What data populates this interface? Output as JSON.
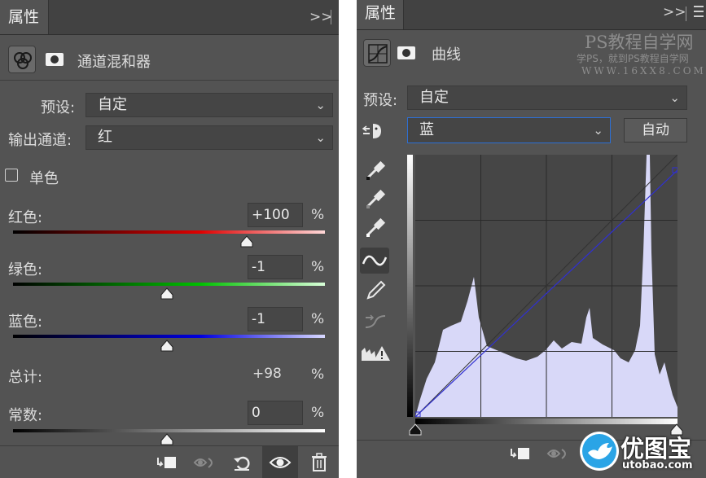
{
  "left": {
    "tab_title": "属性",
    "tab_collapse": ">>",
    "panel_title": "通道混和器",
    "preset_label": "预设:",
    "preset_value": "自定",
    "output_label": "输出通道:",
    "output_value": "红",
    "mono_label": "单色",
    "mono_checked": false,
    "channels": [
      {
        "label": "红色:",
        "value": "+100",
        "unit": "%",
        "level": 1.0
      },
      {
        "label": "绿色:",
        "value": "-1",
        "unit": "%",
        "level": -0.01
      },
      {
        "label": "蓝色:",
        "value": "-1",
        "unit": "%",
        "level": -0.01
      }
    ],
    "total_label": "总计:",
    "total_value": "+98",
    "total_unit": "%",
    "constant_label": "常数:",
    "constant_value": "0",
    "constant_unit": "%",
    "constant_level": 0.0,
    "bottom_icons": [
      "clip-to-layer-icon",
      "toggle-visibility-preview-icon",
      "reset-icon",
      "eye-icon",
      "trash-icon"
    ]
  },
  "right": {
    "tab_title": "属性",
    "tab_collapse": ">>",
    "panel_title": "曲线",
    "watermark_title": "PS教程自学网",
    "watermark_sub": "学PS，就到PS教程自学网",
    "watermark_url": "WWW.16XX8.COM",
    "preset_label": "预设:",
    "preset_value": "自定",
    "channel_value": "蓝",
    "auto_label": "自动",
    "tools": [
      "on-image-adjust-icon",
      "black-point-eyedropper-icon",
      "gray-point-eyedropper-icon",
      "white-point-eyedropper-icon",
      "curve-points-icon",
      "pencil-icon",
      "smooth-icon",
      "clipping-warning-icon"
    ],
    "curve_points": [
      [
        0,
        0
      ],
      [
        255,
        240
      ]
    ],
    "histogram_color": "#d8d8f8",
    "curve_color": "#3030d0"
  },
  "watermark_logo": {
    "name": "优图宝",
    "url": "utobao.com"
  }
}
